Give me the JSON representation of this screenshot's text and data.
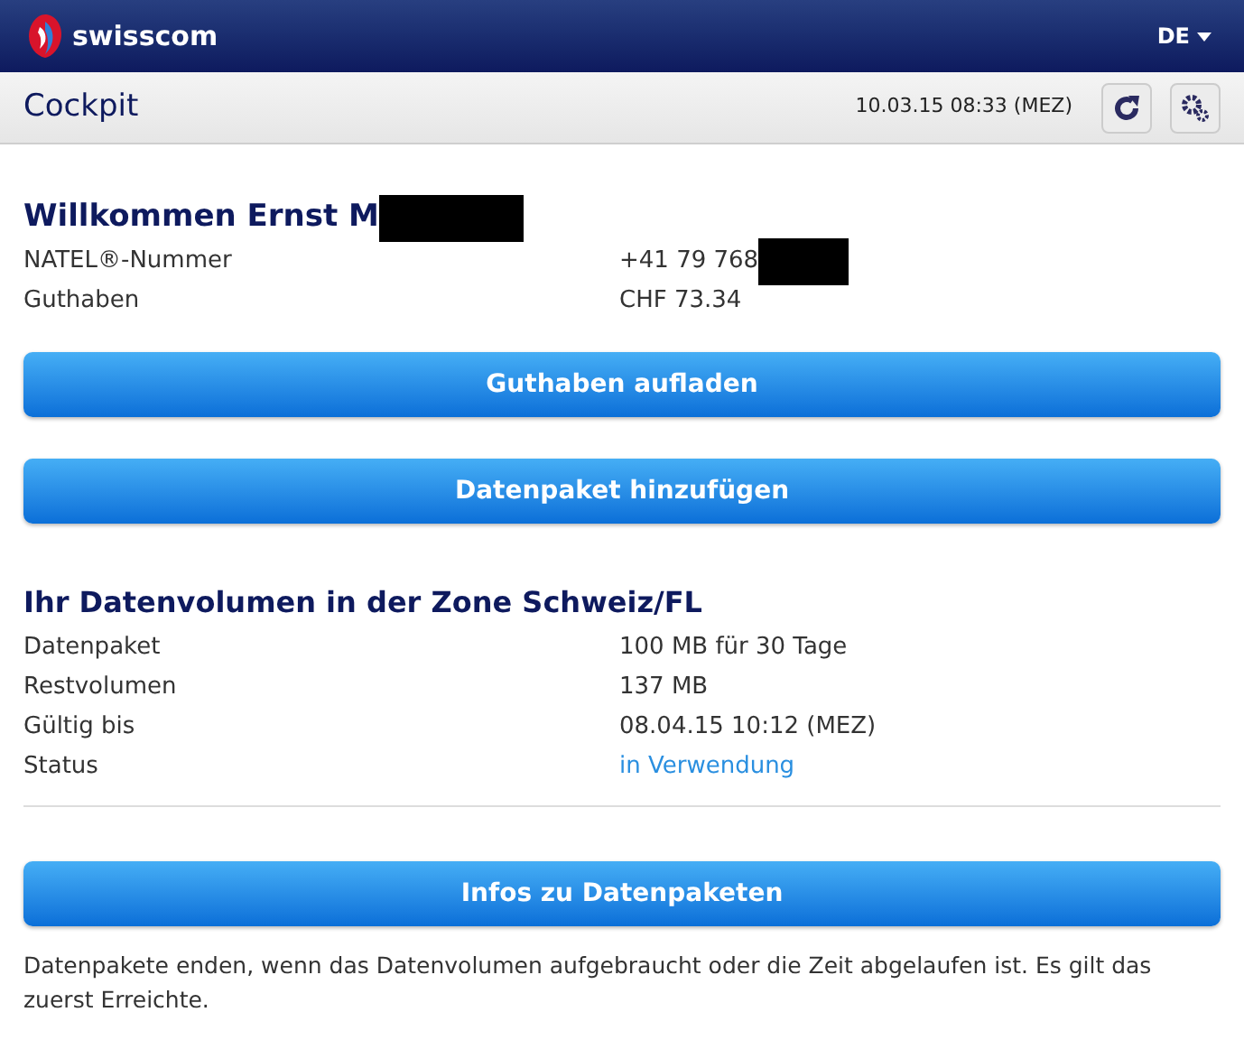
{
  "header": {
    "brand": "swisscom",
    "language": "DE"
  },
  "toolbar": {
    "title": "Cockpit",
    "timestamp": "10.03.15 08:33 (MEZ)"
  },
  "account": {
    "greeting": "Willkommen Ernst M",
    "greeting_redacted": true,
    "rows": [
      {
        "label": "NATEL®-Nummer",
        "value": "+41 79 768",
        "redacted": true
      },
      {
        "label": "Guthaben",
        "value": "CHF 73.34",
        "redacted": false
      }
    ]
  },
  "actions": [
    "Guthaben aufladen",
    "Datenpaket hinzufügen"
  ],
  "data_volume": {
    "title": "Ihr Datenvolumen in der Zone Schweiz/FL",
    "rows": [
      {
        "label": "Datenpaket",
        "value": "100 MB für 30 Tage",
        "kind": "plain"
      },
      {
        "label": "Restvolumen",
        "value": "137 MB",
        "kind": "plain"
      },
      {
        "label": "Gültig bis",
        "value": "08.04.15 10:12 (MEZ)",
        "kind": "plain"
      },
      {
        "label": "Status",
        "value": "in Verwendung",
        "kind": "status"
      }
    ]
  },
  "info_button": "Infos zu Datenpaketen",
  "footnote": "Datenpakete enden, wenn das Datenvolumen aufgebraucht oder die Zeit abgelaufen ist. Es gilt das zuerst Erreichte."
}
